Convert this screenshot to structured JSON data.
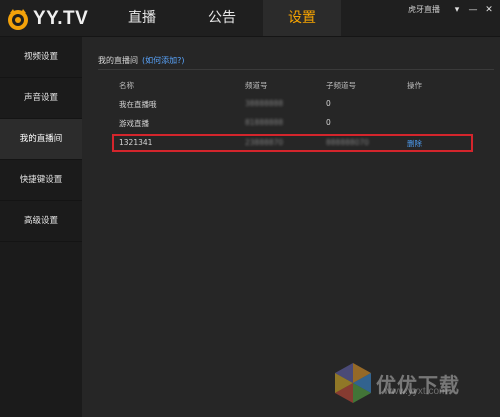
{
  "app": {
    "logo_text": "YY.TV"
  },
  "tabs": [
    {
      "label": "直播"
    },
    {
      "label": "公告"
    },
    {
      "label": "设置"
    }
  ],
  "header": {
    "username": "虎牙直播",
    "controls": [
      "▾",
      "—",
      "✕"
    ]
  },
  "sidebar": {
    "items": [
      {
        "label": "视频设置"
      },
      {
        "label": "声音设置"
      },
      {
        "label": "我的直播间"
      },
      {
        "label": "快捷键设置"
      },
      {
        "label": "高级设置"
      }
    ]
  },
  "section": {
    "title": "我的直播间",
    "help_link": "(如何添加?)"
  },
  "table": {
    "columns": [
      "名称",
      "频道号",
      "子频道号",
      "操作"
    ],
    "rows": [
      {
        "name": "我在直播哦",
        "channel": "38888888",
        "subchannel": "0",
        "action": ""
      },
      {
        "name": "游戏直播",
        "channel": "81888888",
        "subchannel": "0",
        "action": ""
      },
      {
        "name": "1321341",
        "channel": "23888870",
        "subchannel": "888888070",
        "action": "删除"
      }
    ]
  },
  "watermark": {
    "text": "优优下载",
    "url": "www.yyxt.com"
  },
  "colors": {
    "accent": "#f6a300",
    "highlight_border": "#d4252c",
    "link": "#4d9cf0"
  }
}
